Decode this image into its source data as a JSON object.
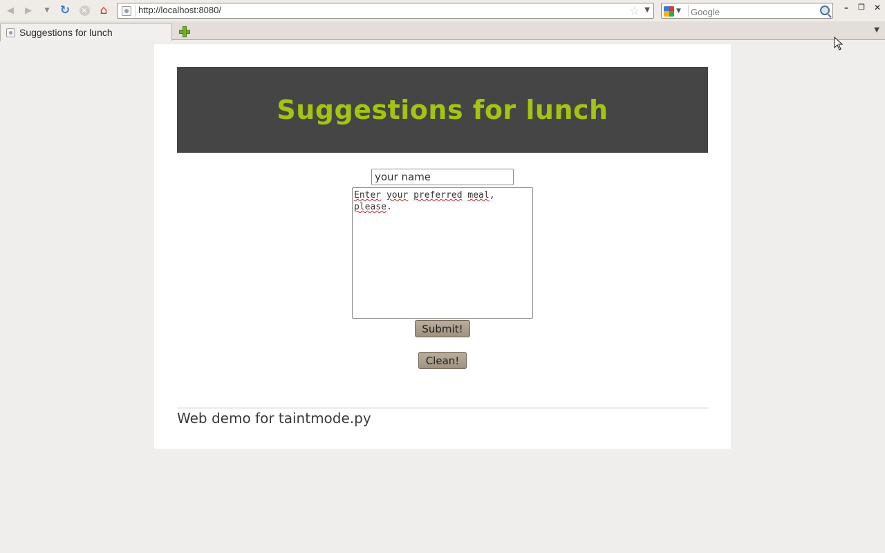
{
  "browser": {
    "url": "http://localhost:8080/",
    "search_placeholder": "Google",
    "search_engine_icon": "google-icon",
    "tab_title": "Suggestions for lunch"
  },
  "page": {
    "title": "Suggestions for lunch",
    "name_field_value": "your name",
    "meal_textarea_line1": [
      "Enter",
      " ",
      "your",
      " ",
      "preferred",
      " ",
      "meal",
      ","
    ],
    "meal_textarea_line2": [
      "please",
      "."
    ],
    "submit_label": "Submit!",
    "clean_label": "Clean!",
    "footer": "Web demo for taintmode.py"
  },
  "colors": {
    "header_bg": "#454545",
    "title_color": "#a3c510",
    "button_bg": "#a99c88"
  }
}
